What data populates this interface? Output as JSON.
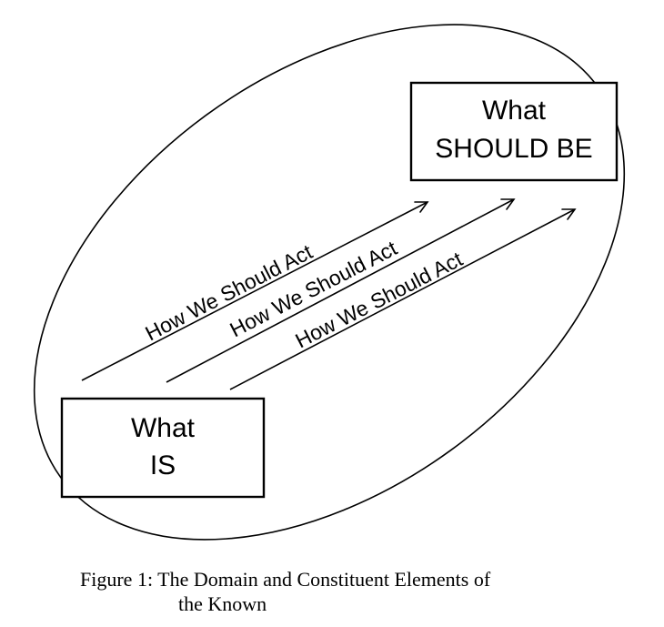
{
  "diagram": {
    "box_top": {
      "line1": "What",
      "line2": "SHOULD BE"
    },
    "box_bottom": {
      "line1": "What",
      "line2": "IS"
    },
    "arrows": [
      {
        "label": "How We Should Act"
      },
      {
        "label": "How We Should Act"
      },
      {
        "label": "How We Should Act"
      }
    ]
  },
  "caption": {
    "line1": "Figure 1: The Domain and Constituent Elements of",
    "line2": "the Known"
  }
}
